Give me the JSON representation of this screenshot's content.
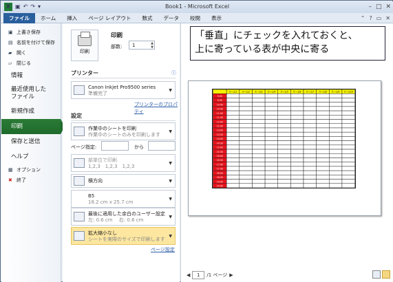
{
  "window": {
    "title": "Book1 - Microsoft Excel"
  },
  "ribbon": {
    "tabs": [
      "ファイル",
      "ホーム",
      "挿入",
      "ページ レイアウト",
      "数式",
      "データ",
      "校閲",
      "表示"
    ]
  },
  "nav": {
    "small_top": [
      "上書き保存",
      "名前を付けて保存",
      "開く",
      "閉じる"
    ],
    "info": "情報",
    "recent_line1": "最近使用した",
    "recent_line2": "ファイル",
    "new": "新規作成",
    "print": "印刷",
    "save_send": "保存と送信",
    "help": "ヘルプ",
    "small_bottom": [
      "オプション",
      "終了"
    ]
  },
  "print": {
    "title": "印刷",
    "button_label": "印刷",
    "copies_label": "部数:",
    "copies_value": "1"
  },
  "printer": {
    "section": "プリンター",
    "name": "Canon Inkjet Pro9500 series",
    "status": "準備完了",
    "properties_link": "プリンターのプロパティ"
  },
  "settings": {
    "section": "設定",
    "scope_main": "作業中のシートを印刷",
    "scope_sub": "作業中のシートのみを印刷します",
    "pages_label": "ページ指定:",
    "pages_to": "から",
    "collate_main": "部単位で印刷",
    "collate_sub": "1,2,3　1,2,3　1,2,3",
    "orientation": "横方向",
    "paper_main": "B5",
    "paper_sub": "18.2 cm x 25.7 cm",
    "margins_main": "最後に適用した余白のユーザー設定",
    "margins_sub": "左:  0.6 cm　  右:  0.6 cm",
    "scaling_main": "拡大縮小なし",
    "scaling_sub": "シートを実際のサイズで印刷します",
    "page_setup_link": "ページ設定"
  },
  "callout": {
    "line1": "「垂直」にチェックを入れておくと、",
    "line2": "上に寄っている表が中央に寄る"
  },
  "preview": {
    "header_cells": [
      "",
      "ルーム1",
      "ルーム2",
      "ルーム3",
      "ルーム4",
      "ルーム5",
      "ルーム6",
      "ルーム7",
      "ルーム8",
      "ルーム9",
      "ルーム10"
    ],
    "row_labels": [
      "9:00",
      "9:30",
      "10:00",
      "10:30",
      "11:00",
      "11:30",
      "12:00",
      "12:30",
      "13:00",
      "13:30",
      "14:00",
      "14:30",
      "15:00",
      "15:30",
      "16:00",
      "16:30",
      "17:00",
      "17:30",
      "18:00",
      "18:30",
      "19:00",
      "19:30"
    ],
    "colors": {
      "header": "#f5f200",
      "label": "#e8121b",
      "grid": "#222222"
    }
  },
  "pager": {
    "current": "1",
    "total": "/1 ページ"
  }
}
